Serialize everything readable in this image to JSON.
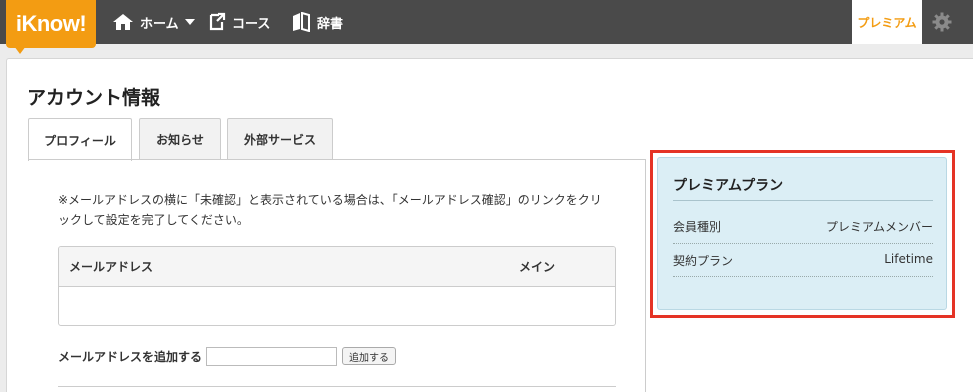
{
  "header": {
    "logo_text": "iKnow!",
    "nav": [
      {
        "label": "ホーム",
        "icon": "home-icon"
      },
      {
        "label": "コース",
        "icon": "course-icon"
      },
      {
        "label": "辞書",
        "icon": "book-icon"
      }
    ],
    "premium_label": "プレミアム",
    "settings_icon": "gear-icon",
    "colors": {
      "bar": "#4a4a4a",
      "accent": "#f39c12"
    }
  },
  "page": {
    "title": "アカウント情報",
    "tabs": [
      {
        "label": "プロフィール",
        "active": true
      },
      {
        "label": "お知らせ",
        "active": false
      },
      {
        "label": "外部サービス",
        "active": false
      }
    ]
  },
  "profile": {
    "notice_line1": "※メールアドレスの横に「未確認」と表示されている場合は、「メールアドレス確認」のリンクをクリ",
    "notice_line2": "ックして設定を完了してください。",
    "table_headers": {
      "email": "メールアドレス",
      "main": "メイン"
    },
    "add_email_label": "メールアドレスを追加する",
    "add_email_value": "",
    "add_button": "追加する"
  },
  "plan": {
    "title": "プレミアムプラン",
    "rows": [
      {
        "label": "会員種別",
        "value": "プレミアムメンバー"
      },
      {
        "label": "契約プラン",
        "value": "Lifetime"
      }
    ],
    "highlight_color": "#e53325",
    "box_color": "#dbeef5"
  }
}
